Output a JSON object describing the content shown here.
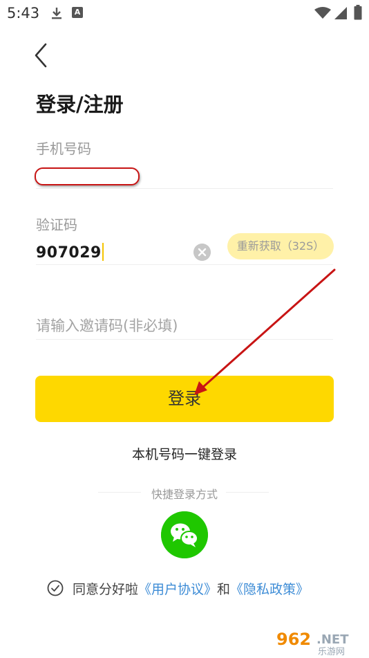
{
  "status_bar": {
    "time": "5:43",
    "icons": [
      "download-icon",
      "a-icon",
      "wifi-icon",
      "signal-icon",
      "battery-icon"
    ]
  },
  "header": {
    "back_icon": "chevron-left-icon",
    "title": "登录/注册"
  },
  "form": {
    "phone_label": "手机号码",
    "phone_value": "",
    "code_label": "验证码",
    "code_value": "907029",
    "resend_label": "重新获取（32S）",
    "invite_placeholder": "请输入邀请码(非必填)"
  },
  "actions": {
    "login_label": "登录",
    "onekey_login_label": "本机号码一键登录"
  },
  "quick_login": {
    "title": "快捷登录方式",
    "wechat_icon": "wechat-icon"
  },
  "agreement": {
    "prefix": "同意分好啦",
    "user_agreement": "《用户协议》",
    "and": "和",
    "privacy_policy": "《隐私政策》"
  },
  "watermark": {
    "logo_number": "962",
    "logo_suffix": ".NET",
    "logo_sub": "乐游网"
  },
  "colors": {
    "accent": "#fed800",
    "resend_bg": "#fff1a8",
    "link": "#3d8cd6",
    "wechat": "#1fc700",
    "annotation": "#c81414"
  }
}
